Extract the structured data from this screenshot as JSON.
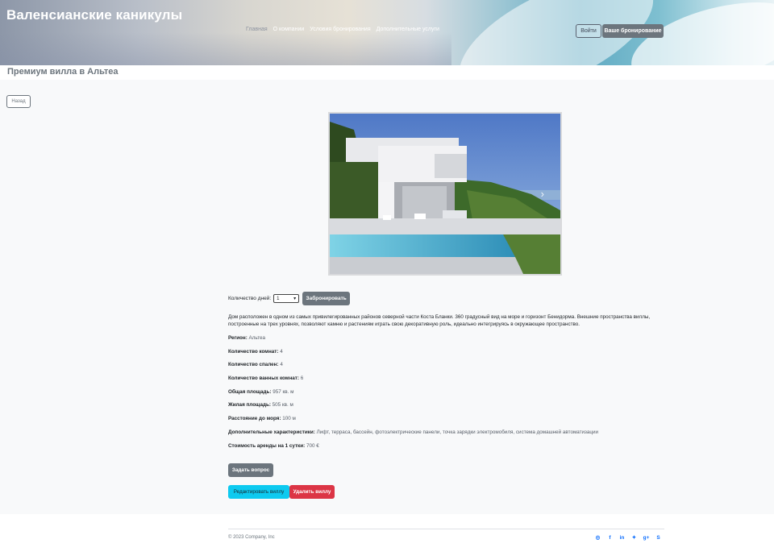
{
  "header": {
    "brand": "Валенсианские каникулы",
    "nav": [
      {
        "label": "Главная",
        "active": true
      },
      {
        "label": "О компании",
        "active": false
      },
      {
        "label": "Условия бронирования",
        "active": false
      },
      {
        "label": "Дополнительные услуги",
        "active": false
      }
    ],
    "login_label": "Войти",
    "booking_label": "Ваше бронирование"
  },
  "page": {
    "title": "Премиум вилла в Альтеа",
    "back_label": "Назад"
  },
  "gallery": {
    "next_icon": "chevron-right-icon"
  },
  "booking": {
    "days_label": "Количество дней:",
    "days_value": "1",
    "book_label": "Забронировать"
  },
  "description": "Дом расположен в одном из самых привилегированных районов северной части Коста Бланки. 360 градусный вид на море и горизонт Бенидорма. Внешние пространства виллы, построенные на трех уровнях, позволяют камню и растениям играть свою декоративную роль, идеально интегрируясь в окружающее пространство.",
  "properties": [
    {
      "label": "Регион:",
      "value": "Альтеа"
    },
    {
      "label": "Количество комнат:",
      "value": "4"
    },
    {
      "label": "Количество спален:",
      "value": "4"
    },
    {
      "label": "Количество ванных комнат:",
      "value": "6"
    },
    {
      "label": "Общая площадь:",
      "value": "957 кв. м"
    },
    {
      "label": "Жилая площадь:",
      "value": "505 кв. м"
    },
    {
      "label": "Расстояние до моря:",
      "value": "100 м"
    },
    {
      "label": "Дополнительные характеристики:",
      "value": "Лифт, терраса, бассейн, фотоэлектрические панели, точка зарядки электромобиля, система домашней автоматизации"
    },
    {
      "label": "Стоимость аренды на 1 сутки:",
      "value": "700 €"
    }
  ],
  "actions": {
    "ask_label": "Задать вопрос",
    "edit_label": "Редактировать виллу",
    "delete_label": "Удалить виллу"
  },
  "footer": {
    "copyright": "© 2023 Company, Inc",
    "socials": [
      "instagram-icon",
      "facebook-icon",
      "linkedin-icon",
      "twitter-icon",
      "google-plus-icon",
      "skype-icon"
    ]
  },
  "colors": {
    "secondary": "#6c757d",
    "info": "#0dcaf0",
    "danger": "#dc3545",
    "link": "#0d6efd"
  }
}
